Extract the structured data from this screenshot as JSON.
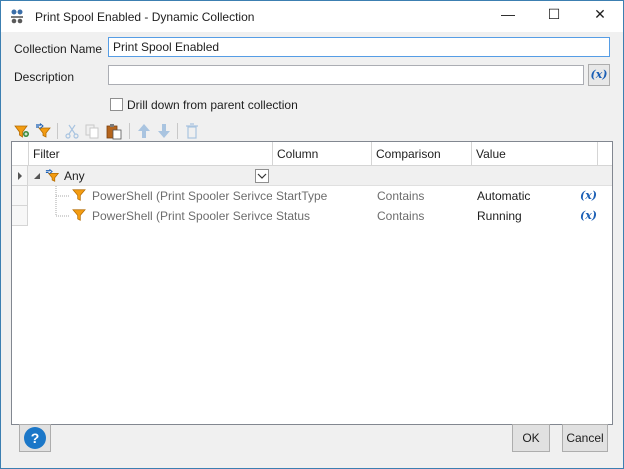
{
  "window": {
    "title": "Print Spool Enabled - Dynamic Collection",
    "minimize_glyph": "—",
    "maximize_glyph": "☐",
    "close_glyph": "✕"
  },
  "form": {
    "collection_name_label": "Collection Name",
    "collection_name_value": "Print Spool Enabled",
    "description_label": "Description",
    "description_value": "",
    "variable_button": "(x)",
    "drill_down_label": "Drill down from parent collection",
    "drill_down_checked": false
  },
  "toolbar": {
    "icons": [
      "filter-add-icon",
      "filter-group-icon",
      "cut-icon",
      "copy-icon",
      "paste-icon",
      "move-up-icon",
      "move-down-icon",
      "delete-icon"
    ]
  },
  "grid": {
    "columns": [
      "Filter",
      "Column",
      "Comparison",
      "Value"
    ],
    "group_label": "Any",
    "rows": [
      {
        "filter": "PowerShell (Print Spooler Serivce)",
        "column": "StartType",
        "comparison": "Contains",
        "value": "Automatic",
        "var": "(x)"
      },
      {
        "filter": "PowerShell (Print Spooler Serivce)",
        "column": "Status",
        "comparison": "Contains",
        "value": "Running",
        "var": "(x)"
      }
    ]
  },
  "buttons": {
    "help": "?",
    "ok": "OK",
    "cancel": "Cancel"
  },
  "colors": {
    "accent": "#1b5fb5",
    "filter_icon": "#f39c12",
    "help_button": "#1b77c8"
  }
}
